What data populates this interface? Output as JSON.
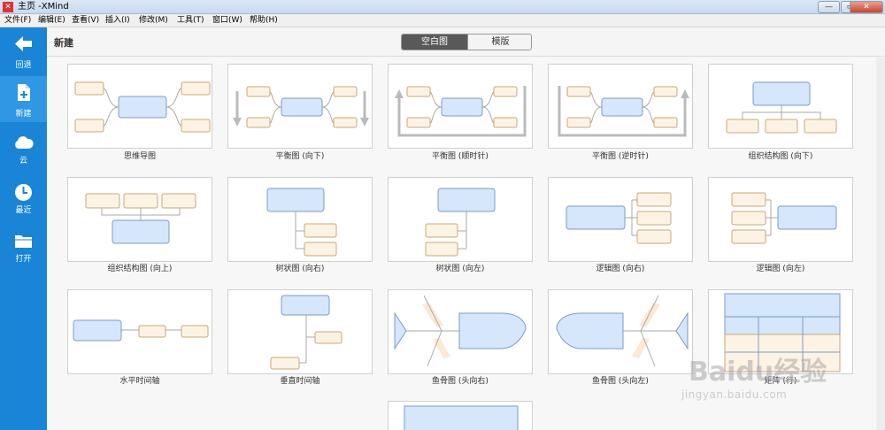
{
  "window": {
    "title": "主页 -XMind",
    "controls": [
      "minimize",
      "maximize",
      "close"
    ]
  },
  "menu": [
    "文件(F)",
    "编辑(E)",
    "查看(V)",
    "插入(I)",
    "修改(M)",
    "工具(T)",
    "窗口(W)",
    "帮助(H)"
  ],
  "sidebar": {
    "items": [
      {
        "label": "回退",
        "icon": "back-arrow-icon"
      },
      {
        "label": "新建",
        "icon": "new-file-icon"
      },
      {
        "label": "云",
        "icon": "cloud-icon"
      },
      {
        "label": "最近",
        "icon": "clock-icon"
      },
      {
        "label": "打开",
        "icon": "folder-icon"
      }
    ],
    "active": "新建"
  },
  "header": {
    "title": "新建",
    "tabs": [
      "空白图",
      "模版"
    ],
    "active_tab": "空白图"
  },
  "templates": [
    {
      "label": "思维导图",
      "diagram": "mindmap"
    },
    {
      "label": "平衡图 (向下)",
      "diagram": "balance-down"
    },
    {
      "label": "平衡图 (顺时针)",
      "diagram": "balance-clockwise"
    },
    {
      "label": "平衡图 (逆时针)",
      "diagram": "balance-counterclockwise"
    },
    {
      "label": "组织结构图 (向下)",
      "diagram": "org-down"
    },
    {
      "label": "组织结构图 (向上)",
      "diagram": "org-up"
    },
    {
      "label": "树状图 (向右)",
      "diagram": "tree-right"
    },
    {
      "label": "树状图 (向左)",
      "diagram": "tree-left"
    },
    {
      "label": "逻辑图 (向右)",
      "diagram": "logic-right"
    },
    {
      "label": "逻辑图 (向左)",
      "diagram": "logic-left"
    },
    {
      "label": "水平时间轴",
      "diagram": "timeline-horizontal"
    },
    {
      "label": "垂直时间轴",
      "diagram": "timeline-vertical"
    },
    {
      "label": "鱼骨图 (头向右)",
      "diagram": "fishbone-right"
    },
    {
      "label": "鱼骨图 (头向左)",
      "diagram": "fishbone-left"
    },
    {
      "label": "矩阵 (行)",
      "diagram": "matrix"
    },
    {
      "label": "",
      "diagram": "partial"
    }
  ],
  "watermark": {
    "text": "Baidu经验",
    "sub": "jingyan.baidu.com"
  },
  "colors": {
    "sidebar": "#1a85d6",
    "topic_fill": "#d6e6fb",
    "topic_stroke": "#7b9cc9",
    "sub_fill": "#fdf3e4",
    "sub_stroke": "#c9a77a"
  }
}
